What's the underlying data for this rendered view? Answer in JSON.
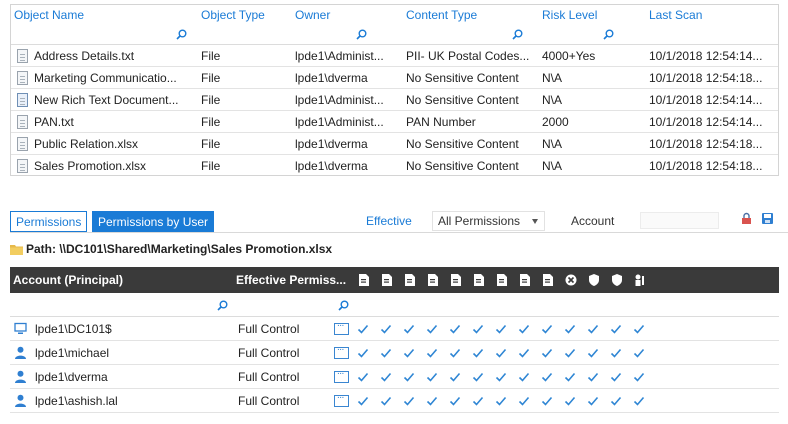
{
  "files_grid": {
    "columns": [
      "Object Name",
      "Object Type",
      "Owner",
      "Content Type",
      "Risk Level",
      "Last Scan"
    ],
    "rows": [
      {
        "icon": "text-document-icon",
        "name": "Address Details.txt",
        "type": "File",
        "owner": "lpde1\\Administ...",
        "content": "PII- UK Postal Codes...",
        "risk": "4000+Yes",
        "scan": "10/1/2018 12:54:14..."
      },
      {
        "icon": "text-document-icon",
        "name": "Marketing Communicatio...",
        "type": "File",
        "owner": "lpde1\\dverma",
        "content": "No Sensitive Content",
        "risk": "N\\A",
        "scan": "10/1/2018 12:54:18..."
      },
      {
        "icon": "rich-text-document-icon",
        "name": "New Rich Text Document...",
        "type": "File",
        "owner": "lpde1\\Administ...",
        "content": "No Sensitive Content",
        "risk": "N\\A",
        "scan": "10/1/2018 12:54:14..."
      },
      {
        "icon": "text-document-icon",
        "name": "PAN.txt",
        "type": "File",
        "owner": "lpde1\\Administ...",
        "content": "PAN Number",
        "risk": "2000",
        "scan": "10/1/2018 12:54:14..."
      },
      {
        "icon": "text-document-icon",
        "name": "Public Relation.xlsx",
        "type": "File",
        "owner": "lpde1\\dverma",
        "content": "No Sensitive Content",
        "risk": "N\\A",
        "scan": "10/1/2018 12:54:18..."
      },
      {
        "icon": "text-document-icon",
        "name": "Sales Promotion.xlsx",
        "type": "File",
        "owner": "lpde1\\dverma",
        "content": "No Sensitive Content",
        "risk": "N\\A",
        "scan": "10/1/2018 12:54:18..."
      }
    ]
  },
  "tabs": {
    "permissions": "Permissions",
    "permissions_by_user": "Permissions by User"
  },
  "toolbar": {
    "effective_label": "Effective",
    "permission_filter": "All Permissions",
    "account_label": "Account",
    "account_value": ""
  },
  "path": {
    "label": "Path: \\\\DC101\\Shared\\Marketing\\Sales Promotion.xlsx"
  },
  "perm_grid": {
    "columns": [
      "Account (Principal)",
      "Effective Permiss..."
    ],
    "permission_icons": [
      "read-data-icon",
      "create-files-icon",
      "append-data-icon",
      "read-attributes-icon",
      "write-attributes-icon",
      "read-extended-attributes-icon",
      "write-extended-attributes-icon",
      "traverse-icon",
      "list-folder-icon",
      "delete-icon",
      "read-permissions-icon",
      "change-permissions-icon",
      "take-ownership-icon"
    ],
    "rows": [
      {
        "icon": "computer-icon",
        "account": "lpde1\\DC101$",
        "permission": "Full Control",
        "checks": 13
      },
      {
        "icon": "user-icon",
        "account": "lpde1\\michael",
        "permission": "Full Control",
        "checks": 13
      },
      {
        "icon": "user-icon",
        "account": "lpde1\\dverma",
        "permission": "Full Control",
        "checks": 13
      },
      {
        "icon": "user-icon",
        "account": "lpde1\\ashish.lal",
        "permission": "Full Control",
        "checks": 13
      }
    ]
  },
  "colors": {
    "accent": "#1a7bd6",
    "header_dark": "#3a3a3a",
    "check": "#2f86d4"
  }
}
